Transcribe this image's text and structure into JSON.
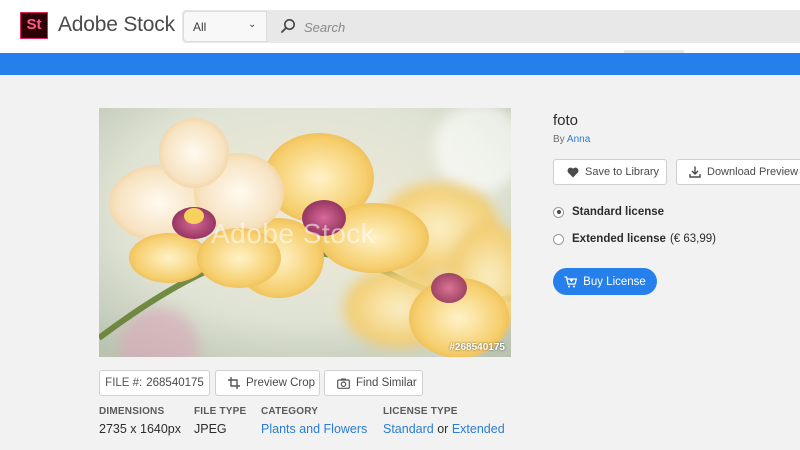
{
  "header": {
    "logo_text": "St",
    "brand": "Adobe Stock",
    "filter_value": "All",
    "search_placeholder": "Search"
  },
  "image": {
    "file_overlay": "#268540175",
    "watermark": "Adobe Stock"
  },
  "image_actions": {
    "file_label": "FILE #:",
    "file_number": "268540175",
    "preview_crop": "Preview Crop",
    "find_similar": "Find Similar"
  },
  "meta": {
    "dimensions_label": "DIMENSIONS",
    "dimensions_value": "2735 x 1640px",
    "filetype_label": "FILE TYPE",
    "filetype_value": "JPEG",
    "category_label": "CATEGORY",
    "category_value": "Plants and Flowers",
    "license_label": "LICENSE TYPE",
    "license_standard": "Standard",
    "license_or": "or",
    "license_extended": "Extended"
  },
  "asset": {
    "title": "foto",
    "by": "By",
    "author": "Anna"
  },
  "actions": {
    "save_to_library": "Save to Library",
    "download_preview": "Download Preview"
  },
  "license": {
    "standard_label": "Standard license",
    "extended_label": "Extended license",
    "extended_price": "(€ 63,99)",
    "selected": "standard"
  },
  "buy": {
    "label": "Buy License"
  },
  "colors": {
    "accent_blue": "#2680eb",
    "link_blue": "#2b7cd3",
    "logo_bg": "#2d0008",
    "logo_accent": "#e0245e"
  }
}
